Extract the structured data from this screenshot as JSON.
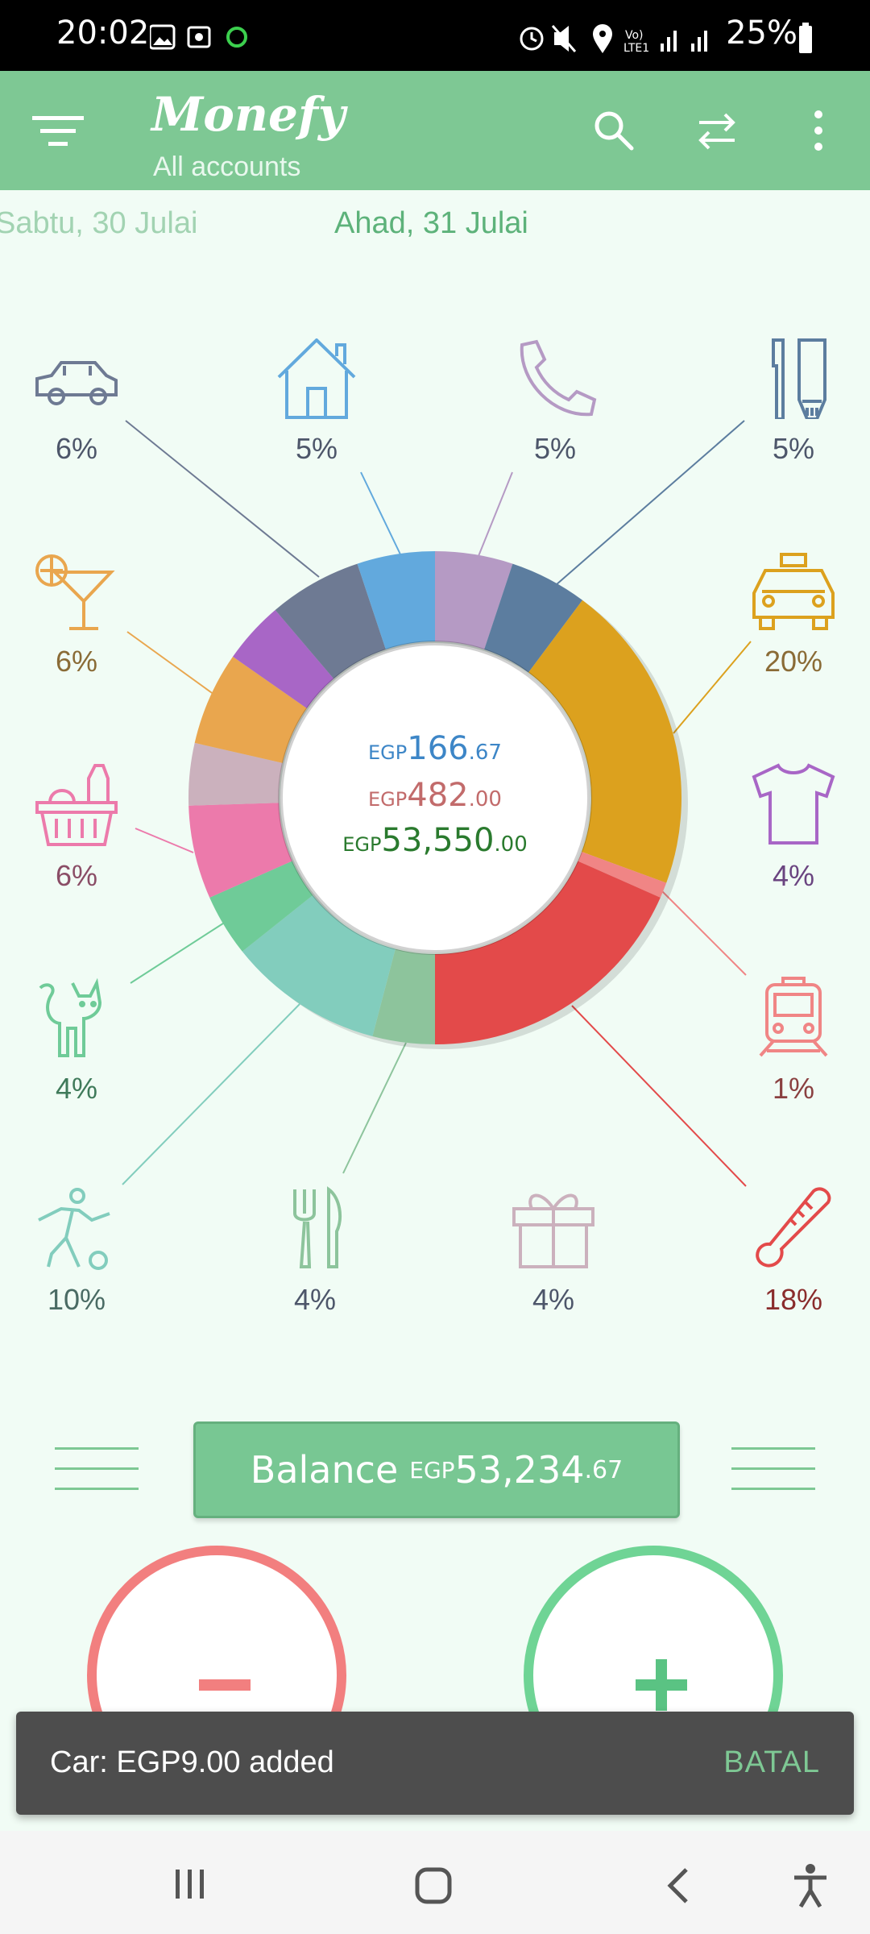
{
  "status_bar": {
    "time": "20:02",
    "battery": "25%"
  },
  "app": {
    "title": "Monefy",
    "subtitle": "All accounts"
  },
  "dates": {
    "previous": "Sabtu, 30 Julai",
    "current": "Ahad, 31 Julai"
  },
  "categories": [
    {
      "id": "car",
      "icon": "car-icon",
      "percent": "6%",
      "color": "#6e7a93"
    },
    {
      "id": "house",
      "icon": "house-icon",
      "percent": "5%",
      "color": "#62a9dd"
    },
    {
      "id": "phone",
      "icon": "phone-icon",
      "percent": "5%",
      "color": "#b59ac4"
    },
    {
      "id": "toiletry",
      "icon": "toothbrush-icon",
      "percent": "5%",
      "color": "#5c7d9f"
    },
    {
      "id": "entertainment",
      "icon": "cocktail-icon",
      "percent": "6%",
      "color": "#e9a64e"
    },
    {
      "id": "taxi",
      "icon": "taxi-icon",
      "percent": "20%",
      "color": "#dca11e"
    },
    {
      "id": "groceries",
      "icon": "basket-icon",
      "percent": "6%",
      "color": "#ec7aab"
    },
    {
      "id": "clothes",
      "icon": "tshirt-icon",
      "percent": "4%",
      "color": "#a866c6"
    },
    {
      "id": "pets",
      "icon": "cat-icon",
      "percent": "4%",
      "color": "#6fcb98"
    },
    {
      "id": "transport",
      "icon": "train-icon",
      "percent": "1%",
      "color": "#f08585"
    },
    {
      "id": "sports",
      "icon": "soccer-player-icon",
      "percent": "10%",
      "color": "#82cdbd"
    },
    {
      "id": "eating-out",
      "icon": "fork-knife-icon",
      "percent": "4%",
      "color": "#8dc49c"
    },
    {
      "id": "gifts",
      "icon": "gift-icon",
      "percent": "4%",
      "color": "#cbb1bd"
    },
    {
      "id": "health",
      "icon": "thermometer-icon",
      "percent": "18%",
      "color": "#e34a4a"
    }
  ],
  "totals": {
    "income": {
      "currency": "EGP",
      "whole": "166",
      "decimal": ".67",
      "color": "#3d86c7"
    },
    "expense": {
      "currency": "EGP",
      "whole": "482",
      "decimal": ".00",
      "color": "#c26b6b"
    },
    "account": {
      "currency": "EGP",
      "whole": "53,550",
      "decimal": ".00",
      "color": "#2a7a2e"
    }
  },
  "balance": {
    "label": "Balance",
    "currency": "EGP",
    "whole": "53,234",
    "decimal": ".67"
  },
  "actions": {
    "expense_symbol": "−",
    "income_symbol": "+"
  },
  "snackbar": {
    "message": "Car: EGP9.00 added",
    "action": "BATAL"
  },
  "colors": {
    "accent": "#7ec894",
    "expense": "#f27f7f",
    "income": "#6fd495"
  }
}
